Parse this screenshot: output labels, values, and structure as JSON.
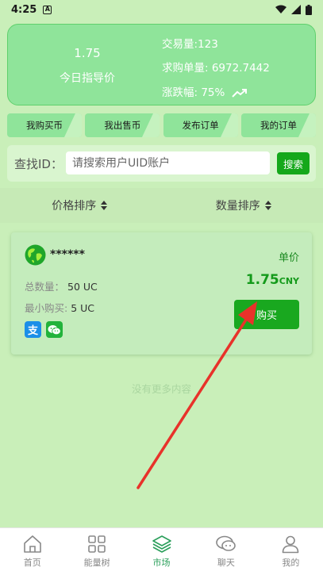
{
  "status_bar": {
    "time": "4:25",
    "notification_glyph": "A"
  },
  "summary": {
    "price": "1.75",
    "price_label": "今日指导价",
    "volume": "交易量:123",
    "buy_volume": "求购单量: 6972.7442",
    "change": "涨跌幅: 75%",
    "trend_icon": "trending-up-icon"
  },
  "actions": [
    {
      "label": "我购买币"
    },
    {
      "label": "我出售币"
    },
    {
      "label": "发布订单"
    },
    {
      "label": "我的订单"
    }
  ],
  "search": {
    "label": "查找ID：",
    "placeholder": "请搜索用户UID账户",
    "button_label": "搜索"
  },
  "sort": {
    "price_sort": "价格排序",
    "quantity_sort": "数量排序"
  },
  "order": {
    "user": "******",
    "unit_label": "单价",
    "price": "1.75",
    "currency": "CNY",
    "total_label": "总数量：",
    "total_value": "50 UC",
    "min_label": "最小购买:",
    "min_value": "5 UC",
    "alipay_glyph": "支",
    "buy_label": "购买"
  },
  "footer_text": "没有更多内容",
  "nav": [
    {
      "label": "首页",
      "icon": "home-icon"
    },
    {
      "label": "能量树",
      "icon": "grid-icon"
    },
    {
      "label": "市场",
      "icon": "layers-icon"
    },
    {
      "label": "聊天",
      "icon": "chat-icon"
    },
    {
      "label": "我的",
      "icon": "user-icon"
    }
  ],
  "colors": {
    "background": "#c9efb9",
    "card": "#8fe49a",
    "accent": "#15a81b",
    "nav_active": "#2b9f5b",
    "arrow": "#e8322a"
  }
}
